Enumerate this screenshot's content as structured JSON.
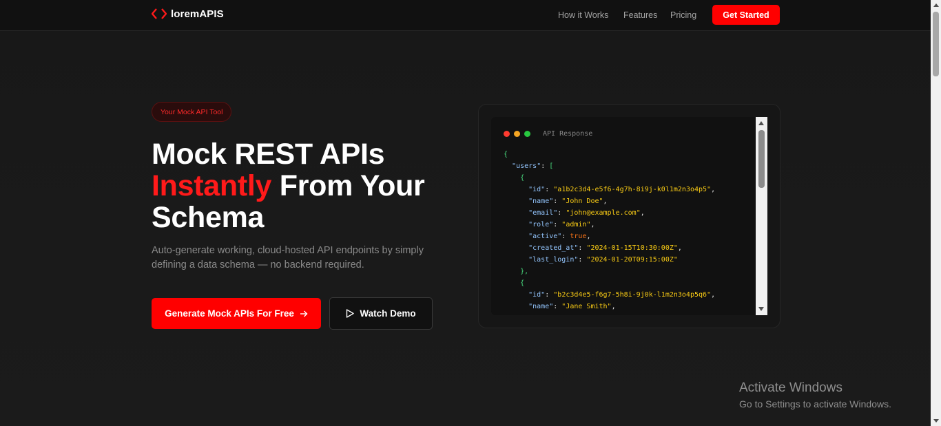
{
  "brand": {
    "name": "loremAPIS",
    "accent": "#ff0000"
  },
  "nav": {
    "links": [
      "How it Works",
      "Features",
      "Pricing"
    ],
    "cta": "Get Started"
  },
  "hero": {
    "badge": "Your Mock API Tool",
    "headline_line1": "Mock REST APIs",
    "headline_highlight": "Instantly",
    "headline_line2_rest": " From Your",
    "headline_line3": "Schema",
    "subtitle": "Auto-generate working, cloud-hosted API endpoints by simply defining a data schema — no backend required.",
    "primary_button": "Generate Mock APIs For Free",
    "secondary_button": "Watch Demo"
  },
  "code_panel": {
    "title": "API Response",
    "root_key": "users",
    "users": [
      {
        "id": "a1b2c3d4-e5f6-4g7h-8i9j-k0l1m2n3o4p5",
        "name": "John Doe",
        "email": "john@example.com",
        "role": "admin",
        "active": "true",
        "created_at": "2024-01-15T10:30:00Z",
        "last_login": "2024-01-20T09:15:00Z"
      },
      {
        "id": "b2c3d4e5-f6g7-5h8i-9j0k-l1m2n3o4p5q6",
        "name": "Jane Smith"
      }
    ]
  },
  "watermark": {
    "title": "Activate Windows",
    "subtitle": "Go to Settings to activate Windows."
  }
}
